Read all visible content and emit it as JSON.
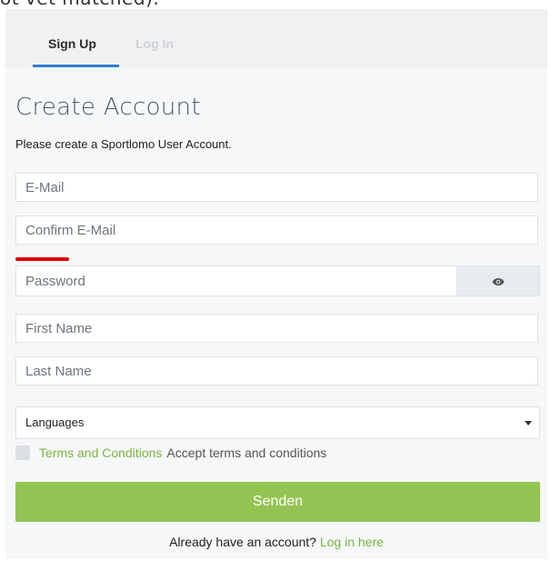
{
  "top_partial_text": "ot vet matched).",
  "tabs": [
    {
      "label": "Sign Up"
    },
    {
      "label": "Log In"
    }
  ],
  "form": {
    "title": "Create Account",
    "subtitle": "Please create a Sportlomo User Account.",
    "email_placeholder": "E-Mail",
    "confirm_email_placeholder": "Confirm E-Mail",
    "password_placeholder": "Password",
    "first_name_placeholder": "First Name",
    "last_name_placeholder": "Last Name",
    "language_select": "Languages",
    "terms_link": "Terms and Conditions",
    "terms_text": "Accept terms and conditions",
    "submit_label": "Senden",
    "footer_text": "Already have an account?",
    "footer_link": "Log in here"
  },
  "icons": {
    "password_toggle": "eye-icon"
  },
  "colors": {
    "tab_accent": "#2f7fd0",
    "submit_bg": "#93c453",
    "link_green": "#7cb342",
    "error_mark": "#e00000"
  }
}
